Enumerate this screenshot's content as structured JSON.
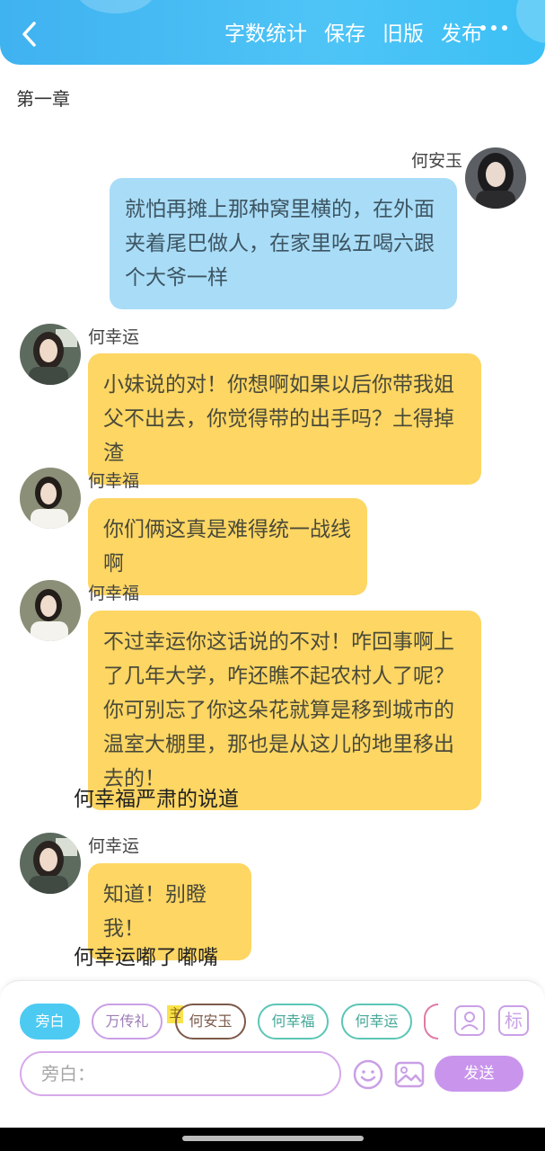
{
  "header": {
    "actions": [
      "字数统计",
      "保存",
      "旧版",
      "发布"
    ]
  },
  "chapter_title": "第一章",
  "messages": [
    {
      "speaker": "何安玉",
      "text": "就怕再摊上那种窝里横的，在外面夹着尾巴做人，在家里吆五喝六跟个大爷一样",
      "side": "right",
      "style": "blue"
    },
    {
      "speaker": "何幸运",
      "text": "小妹说的对！你想啊如果以后你带我姐父不出去，你觉得带的出手吗？土得掉渣",
      "side": "left",
      "style": "yellow"
    },
    {
      "speaker": "何幸福",
      "text": "你们俩这真是难得统一战线啊",
      "side": "left",
      "style": "yellow"
    },
    {
      "speaker": "何幸福",
      "text": "不过幸运你这话说的不对！咋回事啊上了几年大学，咋还瞧不起农村人了呢？你可别忘了你这朵花就算是移到城市的温室大棚里，那也是从这儿的地里移出去的！",
      "side": "left",
      "style": "yellow"
    },
    {
      "speaker": "",
      "text": "何幸福严肃的说道",
      "side": "narration"
    },
    {
      "speaker": "何幸运",
      "text": "知道！别瞪我！",
      "side": "left",
      "style": "yellow"
    },
    {
      "speaker": "",
      "text": "何幸运嘟了嘟嘴",
      "side": "narration"
    }
  ],
  "composer": {
    "roles": [
      "旁白",
      "万传礼",
      "何安玉",
      "何幸福",
      "何幸运"
    ],
    "main_badge": "主",
    "input_placeholder": "旁白：",
    "send_label": "发送",
    "mark_label": "标"
  },
  "colors": {
    "header": "#3fb2f0",
    "blue_bubble": "#a9dcf7",
    "yellow_bubble": "#fdd663",
    "accent_purple": "#c995ec"
  }
}
